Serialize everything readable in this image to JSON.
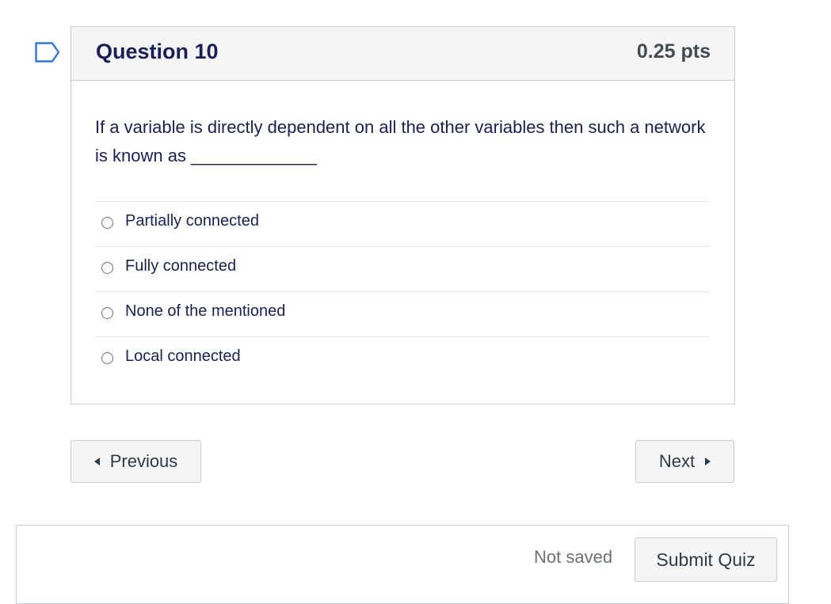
{
  "question": {
    "title": "Question 10",
    "points": "0.25 pts",
    "text": "If a variable is directly dependent on all the other variables then such a network is known as _____________",
    "answers": [
      {
        "label": "Partially connected",
        "selected": false
      },
      {
        "label": "Fully connected",
        "selected": false
      },
      {
        "label": "None of the mentioned",
        "selected": false
      },
      {
        "label": "Local connected",
        "selected": false
      }
    ]
  },
  "navigation": {
    "previous_label": "Previous",
    "next_label": "Next"
  },
  "footer": {
    "save_status": "Not saved",
    "submit_label": "Submit Quiz"
  },
  "icons": {
    "flag": "flag-question-icon",
    "prev": "caret-left-icon",
    "next": "caret-right-icon"
  },
  "colors": {
    "title": "#1b1f59",
    "header_bg": "#f5f5f5",
    "border": "#c7cdd1",
    "flag": "#2d7ad6"
  }
}
